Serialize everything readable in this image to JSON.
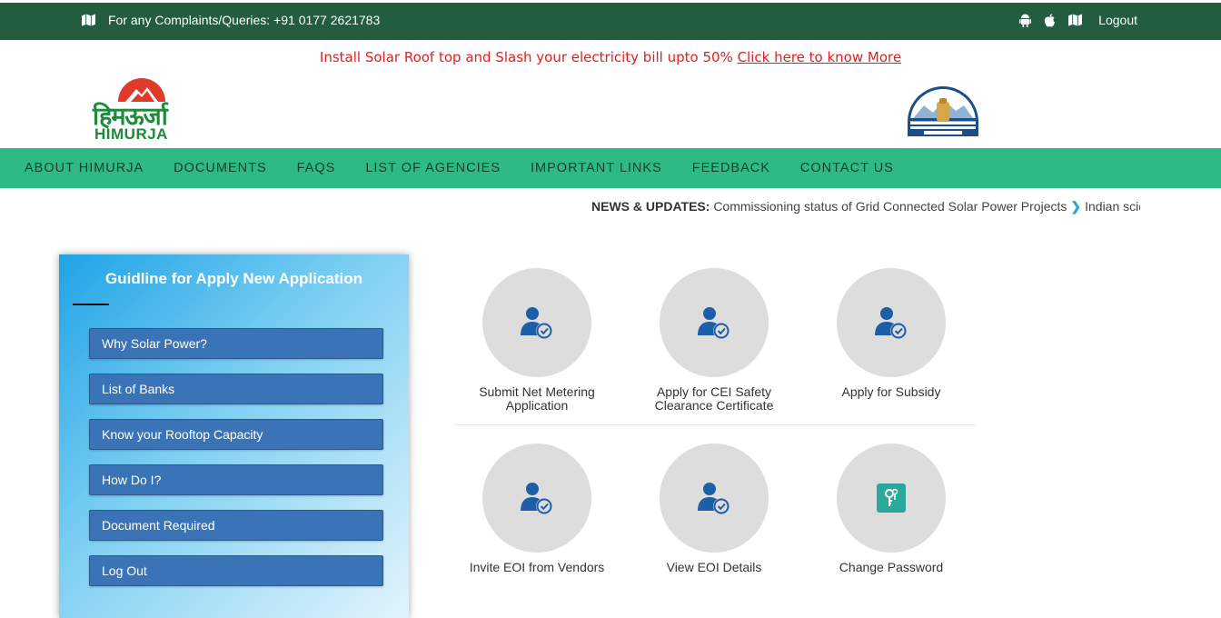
{
  "topbar": {
    "complaint_text": "For any Complaints/Queries: +91 0177 2621783",
    "logout_label": "Logout",
    "icons": [
      "map-icon",
      "android-icon",
      "apple-icon",
      "map-icon"
    ]
  },
  "promo": {
    "text": "Install Solar Roof top and Slash your electricity bill upto 50%",
    "link_label": "Click here to know More"
  },
  "logo": {
    "hindi": "हिमऊर्जा",
    "english": "HIMURJA"
  },
  "nav": {
    "items": [
      "ABOUT HIMURJA",
      "DOCUMENTS",
      "FAQS",
      "LIST OF AGENCIES",
      "IMPORTANT LINKS",
      "FEEDBACK",
      "CONTACT US"
    ]
  },
  "news": {
    "label": "NEWS & UPDATES:",
    "item1": "Commissioning status of Grid Connected Solar Power Projects",
    "item2": "Indian scientis"
  },
  "guideline": {
    "title": "Guidline for Apply New Application",
    "buttons": [
      "Why Solar Power?",
      "List of Banks",
      "Know your Rooftop Capacity",
      "How Do I?",
      "Document Required",
      "Log Out"
    ]
  },
  "tiles": {
    "t1": {
      "line1": "Submit Net Metering",
      "line2": "Application",
      "icon": "user-check-icon"
    },
    "t2": {
      "line1": "Apply for CEI Safety",
      "line2": "Clearance Certificate",
      "icon": "user-check-icon"
    },
    "t3": {
      "line1": "Apply for Subsidy",
      "icon": "user-check-icon"
    },
    "t4": {
      "line1": "Invite EOI from Vendors",
      "icon": "user-check-icon"
    },
    "t5": {
      "line1": "View EOI Details",
      "icon": "user-check-icon"
    },
    "t6": {
      "line1": "Change Password",
      "icon": "key-icon"
    }
  },
  "colors": {
    "topbar": "#225d40",
    "nav": "#2dba84",
    "panel_button": "#3a74b6",
    "promo": "#e02020",
    "icon_blue": "#1d5fa7"
  }
}
